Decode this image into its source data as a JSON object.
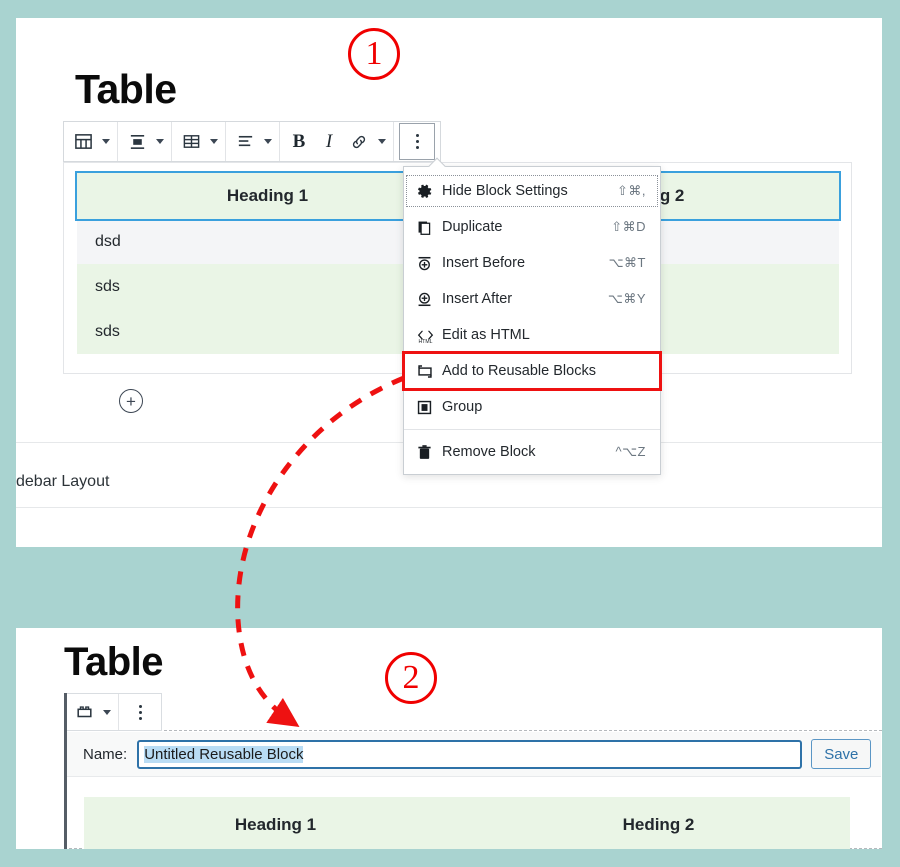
{
  "background_color": "#a9d3d0",
  "accent_red": "#f00000",
  "panel1": {
    "title": "Table",
    "toolbar": {
      "items": [
        {
          "icon": "table-block-icon",
          "has_caret": true
        },
        {
          "icon": "align-block-icon",
          "has_caret": true
        },
        {
          "icon": "edit-table-icon",
          "has_caret": true
        },
        {
          "icon": "align-text-icon",
          "has_caret": true
        },
        {
          "icon": "bold-icon",
          "label": "B"
        },
        {
          "icon": "italic-icon",
          "label": "I"
        },
        {
          "icon": "link-icon"
        },
        {
          "icon": "more-rich-text-caret-icon",
          "has_caret": true
        },
        {
          "icon": "vertical-dots-icon"
        }
      ]
    },
    "table": {
      "headers": [
        "Heading 1",
        "Heding 2"
      ],
      "rows": [
        [
          "dsd",
          ""
        ],
        [
          "sds",
          ""
        ],
        [
          "sds",
          ""
        ]
      ]
    },
    "inserter_icon": "circle-plus-icon",
    "sidebar_label": "debar Layout"
  },
  "menu": {
    "items": [
      {
        "icon": "gear-icon",
        "label": "Hide Block Settings",
        "shortcut": "⇧⌘,",
        "focused": true
      },
      {
        "icon": "duplicate-icon",
        "label": "Duplicate",
        "shortcut": "⇧⌘D"
      },
      {
        "icon": "insert-before-icon",
        "label": "Insert Before",
        "shortcut": "⌥⌘T"
      },
      {
        "icon": "insert-after-icon",
        "label": "Insert After",
        "shortcut": "⌥⌘Y"
      },
      {
        "icon": "html-icon",
        "label": "Edit as HTML",
        "shortcut": ""
      },
      {
        "icon": "reusable-block-icon",
        "label": "Add to Reusable Blocks",
        "shortcut": "",
        "highlight": true
      },
      {
        "icon": "group-icon",
        "label": "Group",
        "shortcut": ""
      },
      {
        "icon": "trash-icon",
        "label": "Remove Block",
        "shortcut": "^⌥Z",
        "separator_before": true
      }
    ]
  },
  "panel2": {
    "title": "Table",
    "toolbar": {
      "items": [
        {
          "icon": "reusable-block-icon",
          "has_caret": true
        },
        {
          "icon": "vertical-dots-icon"
        }
      ]
    },
    "name_label": "Name:",
    "name_value": "Untitled Reusable Block",
    "save_label": "Save",
    "table": {
      "headers": [
        "Heading 1",
        "Heding 2"
      ]
    }
  },
  "annotations": {
    "step1": "1",
    "step2": "2",
    "arrow": "dashed-red-arrow"
  }
}
